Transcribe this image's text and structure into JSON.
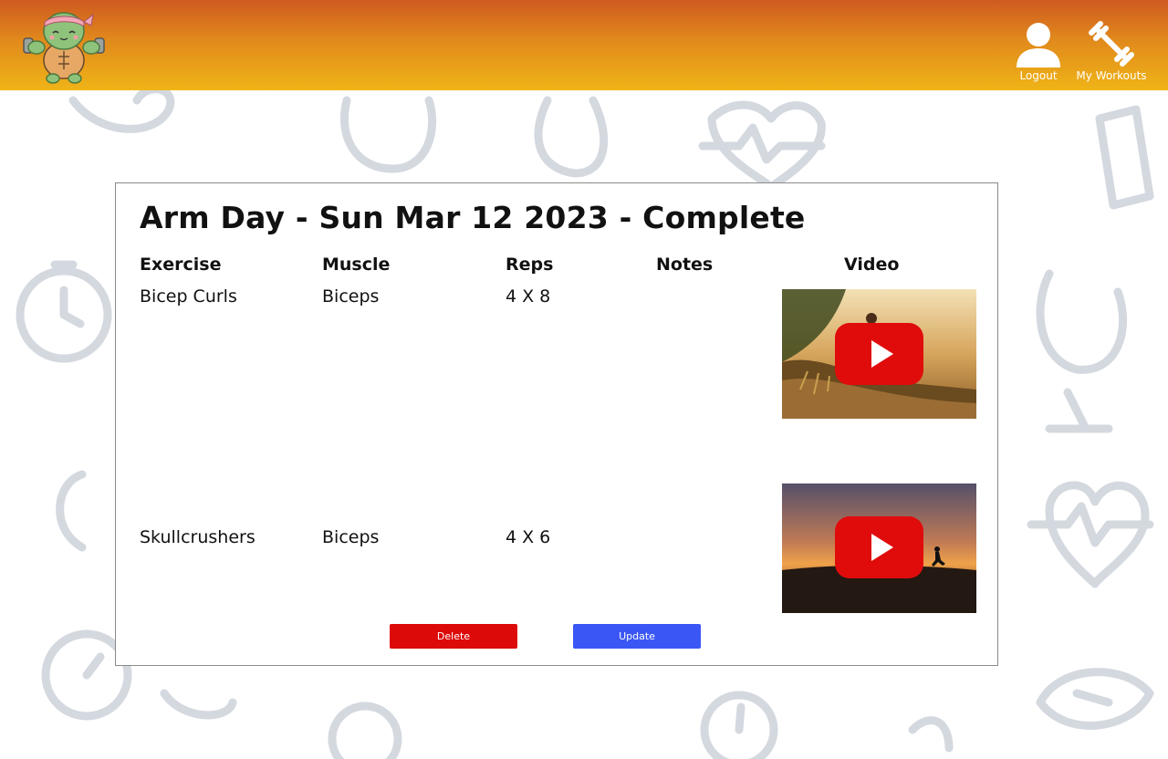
{
  "header": {
    "logo_icon": "turtle-mascot-logo",
    "nav": [
      {
        "label": "Logout",
        "icon": "user-icon"
      },
      {
        "label": "My Workouts",
        "icon": "dumbbell-icon"
      }
    ],
    "colors": {
      "gradient_top": "#cf5a20",
      "gradient_bottom": "#efb417"
    }
  },
  "workout": {
    "title": "Arm Day - Sun Mar 12 2023 - Complete",
    "columns": [
      "Exercise",
      "Muscle",
      "Reps",
      "Notes",
      "Video"
    ],
    "rows": [
      {
        "exercise": "Bicep Curls",
        "muscle": "Biceps",
        "reps": "4 X 8",
        "notes": "",
        "video_thumbnail": "sunlit-trail-play-thumbnail"
      },
      {
        "exercise": "Skullcrushers",
        "muscle": "Biceps",
        "reps": "4 X 6",
        "notes": "",
        "video_thumbnail": "sunset-runner-play-thumbnail"
      }
    ]
  },
  "actions": {
    "delete_label": "Delete",
    "update_label": "Update",
    "delete_color": "#dd0a0a",
    "update_color": "#3a57f5"
  }
}
